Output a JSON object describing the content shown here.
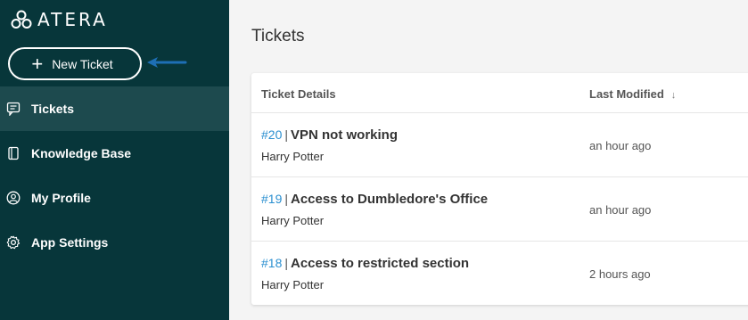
{
  "brand": {
    "name": "ATERA"
  },
  "sidebar": {
    "new_ticket_label": "New Ticket",
    "items": [
      {
        "label": "Tickets",
        "icon": "chat-icon",
        "active": true
      },
      {
        "label": "Knowledge Base",
        "icon": "book-icon",
        "active": false
      },
      {
        "label": "My Profile",
        "icon": "user-icon",
        "active": false
      },
      {
        "label": "App Settings",
        "icon": "gear-icon",
        "active": false
      }
    ]
  },
  "main": {
    "title": "Tickets",
    "table": {
      "columns": [
        "Ticket Details",
        "Last Modified"
      ],
      "sort_indicator": "↓",
      "rows": [
        {
          "id": "#20",
          "subject": "VPN not working",
          "requester": "Harry Potter",
          "modified": "an hour ago"
        },
        {
          "id": "#19",
          "subject": "Access to Dumbledore's Office",
          "requester": "Harry Potter",
          "modified": "an hour ago"
        },
        {
          "id": "#18",
          "subject": "Access to restricted section",
          "requester": "Harry Potter",
          "modified": "2 hours ago"
        }
      ]
    }
  },
  "colors": {
    "sidebar_bg": "#07363a",
    "sidebar_active": "#1d4a4e",
    "link_blue": "#2a8fd0",
    "annotation_arrow": "#1e6fb5"
  }
}
